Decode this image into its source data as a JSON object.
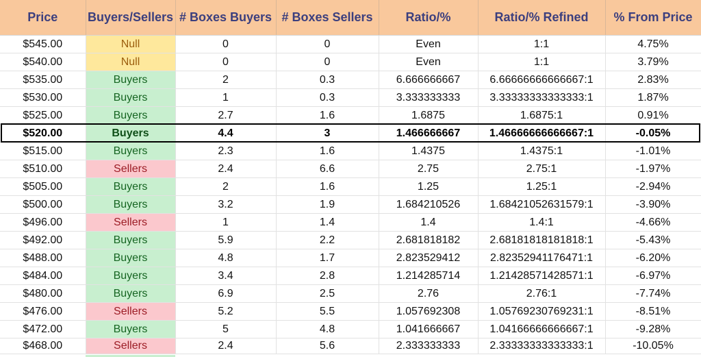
{
  "headers": [
    "Price",
    "Buyers/Sellers",
    "# Boxes Buyers",
    "# Boxes Sellers",
    "Ratio/%",
    "Ratio/% Refined",
    "% From Price"
  ],
  "rows": [
    {
      "price": "$545.00",
      "side": "Null",
      "buyers": "0",
      "sellers": "0",
      "ratio": "Even",
      "refined": "1:1",
      "from_price": "4.75%"
    },
    {
      "price": "$540.00",
      "side": "Null",
      "buyers": "0",
      "sellers": "0",
      "ratio": "Even",
      "refined": "1:1",
      "from_price": "3.79%"
    },
    {
      "price": "$535.00",
      "side": "Buyers",
      "buyers": "2",
      "sellers": "0.3",
      "ratio": "6.666666667",
      "refined": "6.66666666666667:1",
      "from_price": "2.83%"
    },
    {
      "price": "$530.00",
      "side": "Buyers",
      "buyers": "1",
      "sellers": "0.3",
      "ratio": "3.333333333",
      "refined": "3.33333333333333:1",
      "from_price": "1.87%"
    },
    {
      "price": "$525.00",
      "side": "Buyers",
      "buyers": "2.7",
      "sellers": "1.6",
      "ratio": "1.6875",
      "refined": "1.6875:1",
      "from_price": "0.91%"
    },
    {
      "price": "$520.00",
      "side": "Buyers",
      "buyers": "4.4",
      "sellers": "3",
      "ratio": "1.466666667",
      "refined": "1.46666666666667:1",
      "from_price": "-0.05%"
    },
    {
      "price": "$515.00",
      "side": "Buyers",
      "buyers": "2.3",
      "sellers": "1.6",
      "ratio": "1.4375",
      "refined": "1.4375:1",
      "from_price": "-1.01%"
    },
    {
      "price": "$510.00",
      "side": "Sellers",
      "buyers": "2.4",
      "sellers": "6.6",
      "ratio": "2.75",
      "refined": "2.75:1",
      "from_price": "-1.97%"
    },
    {
      "price": "$505.00",
      "side": "Buyers",
      "buyers": "2",
      "sellers": "1.6",
      "ratio": "1.25",
      "refined": "1.25:1",
      "from_price": "-2.94%"
    },
    {
      "price": "$500.00",
      "side": "Buyers",
      "buyers": "3.2",
      "sellers": "1.9",
      "ratio": "1.684210526",
      "refined": "1.68421052631579:1",
      "from_price": "-3.90%"
    },
    {
      "price": "$496.00",
      "side": "Sellers",
      "buyers": "1",
      "sellers": "1.4",
      "ratio": "1.4",
      "refined": "1.4:1",
      "from_price": "-4.66%"
    },
    {
      "price": "$492.00",
      "side": "Buyers",
      "buyers": "5.9",
      "sellers": "2.2",
      "ratio": "2.681818182",
      "refined": "2.68181818181818:1",
      "from_price": "-5.43%"
    },
    {
      "price": "$488.00",
      "side": "Buyers",
      "buyers": "4.8",
      "sellers": "1.7",
      "ratio": "2.823529412",
      "refined": "2.82352941176471:1",
      "from_price": "-6.20%"
    },
    {
      "price": "$484.00",
      "side": "Buyers",
      "buyers": "3.4",
      "sellers": "2.8",
      "ratio": "1.214285714",
      "refined": "1.21428571428571:1",
      "from_price": "-6.97%"
    },
    {
      "price": "$480.00",
      "side": "Buyers",
      "buyers": "6.9",
      "sellers": "2.5",
      "ratio": "2.76",
      "refined": "2.76:1",
      "from_price": "-7.74%"
    },
    {
      "price": "$476.00",
      "side": "Sellers",
      "buyers": "5.2",
      "sellers": "5.5",
      "ratio": "1.057692308",
      "refined": "1.05769230769231:1",
      "from_price": "-8.51%"
    },
    {
      "price": "$472.00",
      "side": "Buyers",
      "buyers": "5",
      "sellers": "4.8",
      "ratio": "1.041666667",
      "refined": "1.04166666666667:1",
      "from_price": "-9.28%"
    },
    {
      "price": "$468.00",
      "side": "Sellers",
      "buyers": "2.4",
      "sellers": "5.6",
      "ratio": "2.333333333",
      "refined": "2.33333333333333:1",
      "from_price": "-10.05%"
    }
  ],
  "current_price_row": 5,
  "colors": {
    "header_bg": "#f9c89c",
    "header_text": "#3c3f7e",
    "buyers_bg": "#c8efcf",
    "buyers_text": "#166522",
    "sellers_bg": "#fbc8cd",
    "sellers_text": "#9c1c25",
    "null_bg": "#fee89c",
    "null_text": "#9b5d0d"
  }
}
